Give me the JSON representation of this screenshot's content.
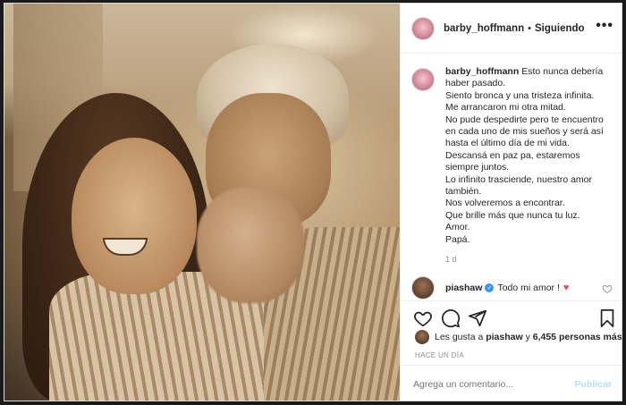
{
  "post": {
    "username": "barby_hoffmann",
    "separator": "•",
    "follow_status": "Siguiendo",
    "more_label": "•••"
  },
  "caption": {
    "username": "barby_hoffmann",
    "lines": [
      "Esto nunca debería",
      "haber pasado.",
      "Siento bronca y una tristeza infinita.",
      "Me arrancaron mi otra mitad.",
      "No pude despedirte pero te encuentro",
      "en cada uno de mis sueños y será así",
      "hasta el último día de mi vida.",
      "Descansá en paz pa, estaremos",
      "siempre juntos.",
      "Lo infinito trasciende, nuestro amor",
      "también.",
      "Nos volveremos a encontrar.",
      "Que brille más que nunca tu luz.",
      "Amor.",
      "Papá."
    ],
    "time": "1 d"
  },
  "comment": {
    "username": "piashaw",
    "text": "Todo mi amor !",
    "emoji": "♥"
  },
  "likes": {
    "prefix": "Les gusta a",
    "user": "piashaw",
    "conj": "y",
    "others": "6,455 personas más"
  },
  "timestamp": "HACE UN DÍA",
  "add_comment": {
    "placeholder": "Agrega un comentario...",
    "post_label": "Publicar"
  },
  "icons": {
    "heart": "heart-icon",
    "comment": "comment-icon",
    "share": "share-icon",
    "save": "bookmark-icon"
  },
  "colors": {
    "verified": "#3897f0",
    "heart": "#ed4956",
    "publish_disabled": "#b2dffc"
  }
}
